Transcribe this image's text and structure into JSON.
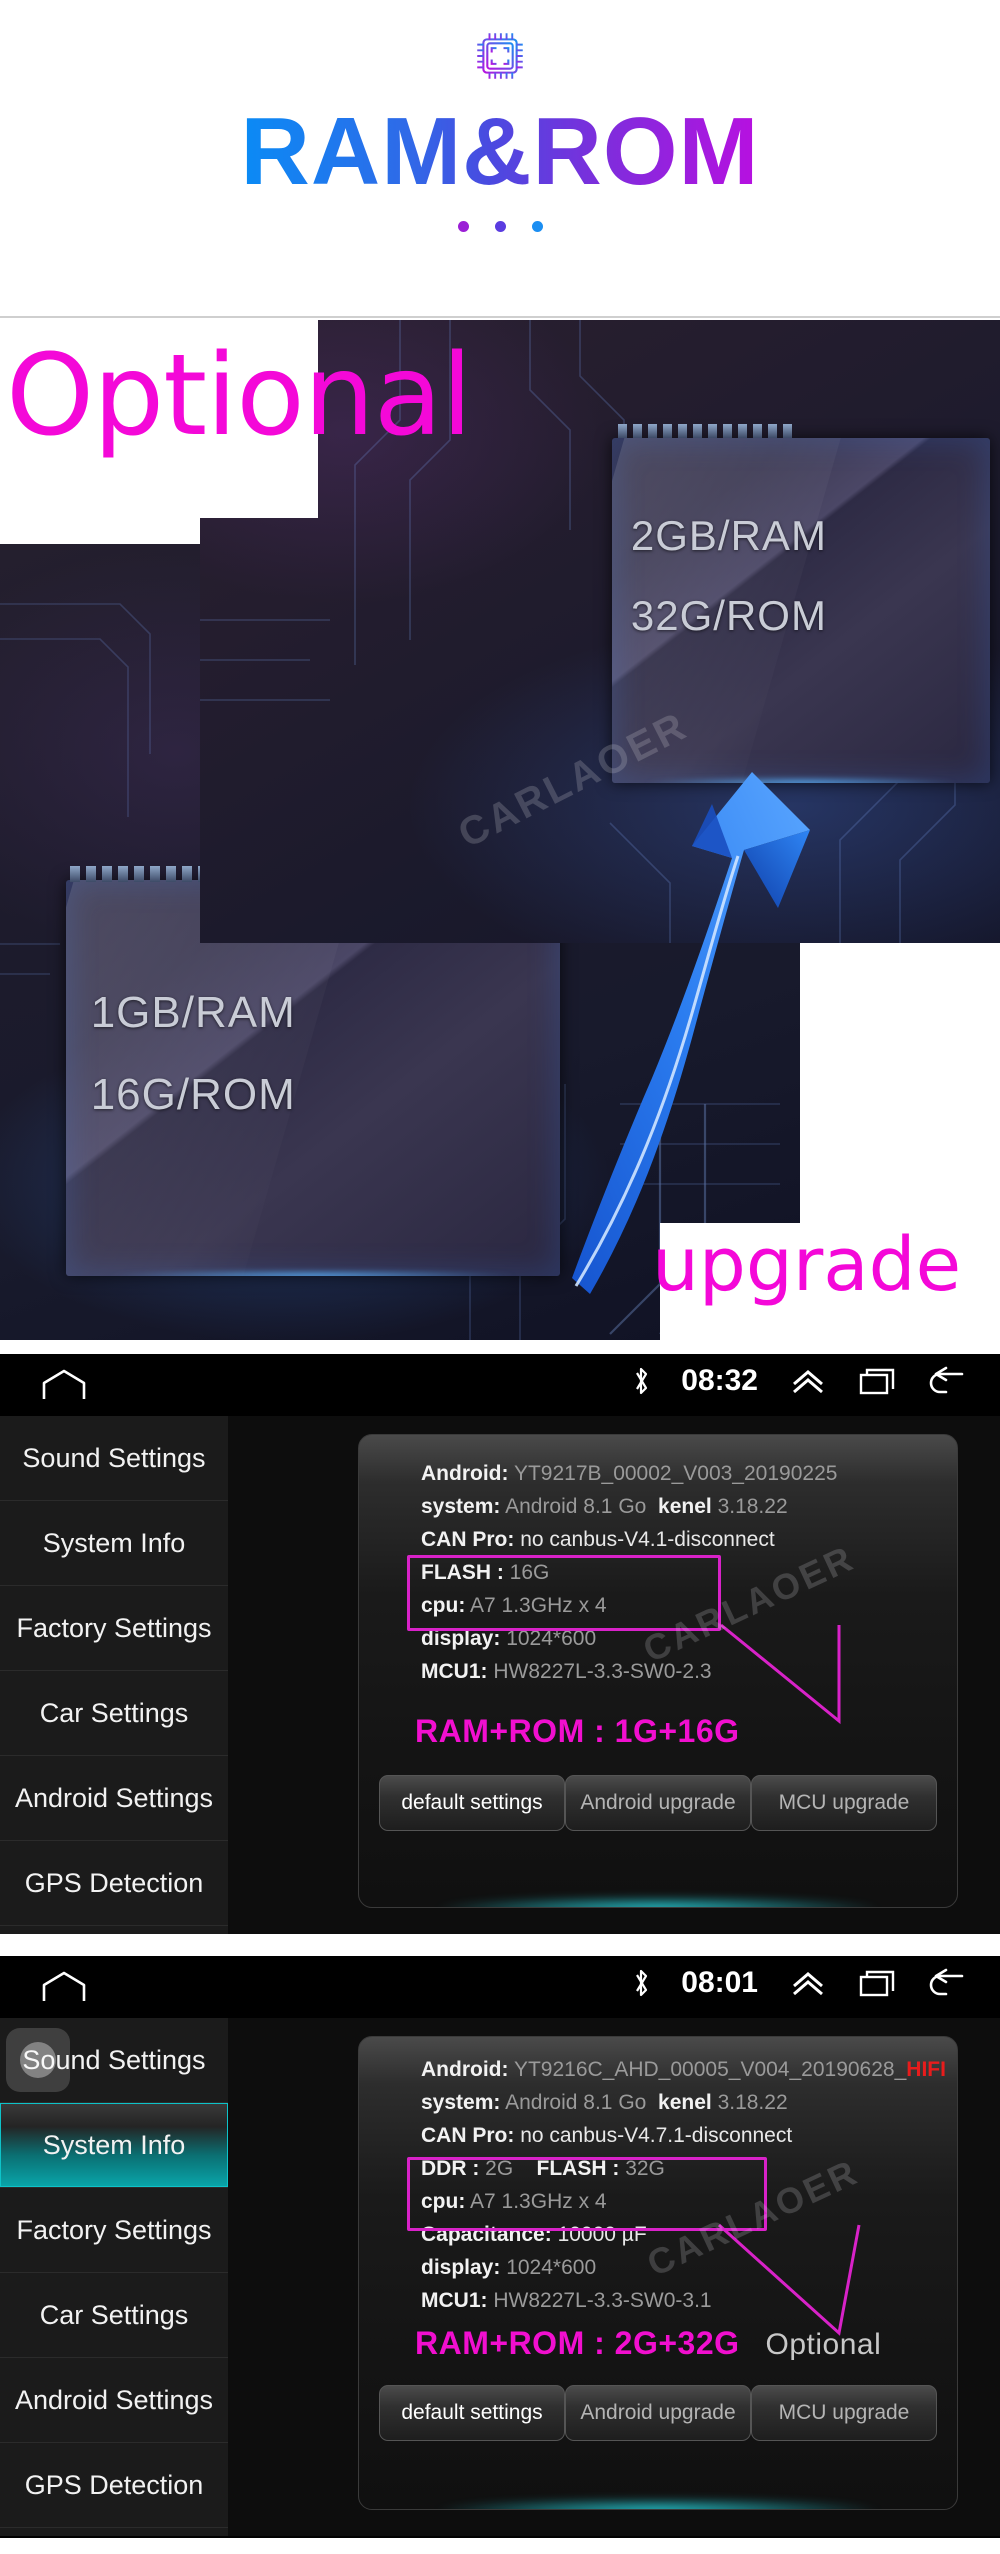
{
  "header": {
    "icon": "cpu-chip-icon",
    "title": "RAM&ROM",
    "dots": [
      "dot-purple",
      "dot-indigo",
      "dot-blue"
    ]
  },
  "hero": {
    "optional_label": "Optional",
    "upgrade_label": "upgrade",
    "watermark": "CARLAOER",
    "chip_top": {
      "line1": "2GB/RAM",
      "line2": "32G/ROM"
    },
    "chip_bottom": {
      "line1": "1GB/RAM",
      "line2": "16G/ROM"
    },
    "arrow_color": "#1f6fe0"
  },
  "screenshots": [
    {
      "id": "screenshot-1g-16g",
      "statusbar": {
        "home_icon": "home-icon",
        "bluetooth_icon": "bluetooth-icon",
        "time": "08:32",
        "expand_icon": "chevron-up-double-icon",
        "recents_icon": "recents-icon",
        "back_icon": "back-icon"
      },
      "sidebar": {
        "items": [
          {
            "label": "Sound Settings",
            "active": false
          },
          {
            "label": "System Info",
            "active": false
          },
          {
            "label": "Factory Settings",
            "active": false
          },
          {
            "label": "Car Settings",
            "active": false
          },
          {
            "label": "Android Settings",
            "active": false
          },
          {
            "label": "GPS Detection",
            "active": false
          }
        ]
      },
      "info": [
        {
          "key": "Android:",
          "value": "YT9217B_00002_V003_20190225"
        },
        {
          "key": "system:",
          "value": "Android 8.1 Go",
          "key2": "kenel",
          "value2": "3.18.22"
        },
        {
          "key": "CAN Pro:",
          "value": "no canbus-V4.1-disconnect",
          "bright": true
        },
        {
          "key": "FLASH :",
          "value": "16G"
        },
        {
          "key": "cpu:",
          "value": "A7 1.3GHz x 4"
        },
        {
          "key": "display:",
          "value": "1024*600"
        },
        {
          "key": "MCU1:",
          "value": "HW8227L-3.3-SW0-2.3"
        }
      ],
      "ramrom_label": "RAM+ROM : 1G+16G",
      "optional_tag": "",
      "buttons": [
        "default settings",
        "Android upgrade",
        "MCU upgrade"
      ],
      "watermark": "CARLAOER"
    },
    {
      "id": "screenshot-2g-32g",
      "statusbar": {
        "home_icon": "home-icon",
        "bluetooth_icon": "bluetooth-icon",
        "time": "08:01",
        "expand_icon": "chevron-up-double-icon",
        "recents_icon": "recents-icon",
        "back_icon": "back-icon"
      },
      "sidebar": {
        "items": [
          {
            "label": "Sound Settings",
            "active": false
          },
          {
            "label": "System Info",
            "active": true
          },
          {
            "label": "Factory Settings",
            "active": false
          },
          {
            "label": "Car Settings",
            "active": false
          },
          {
            "label": "Android Settings",
            "active": false
          },
          {
            "label": "GPS Detection",
            "active": false
          }
        ]
      },
      "info": [
        {
          "key": "Android:",
          "value": "YT9216C_AHD_00005_V004_20190628_",
          "suffix": "HIFI"
        },
        {
          "key": "system:",
          "value": "Android 8.1 Go",
          "key2": "kenel",
          "value2": "3.18.22"
        },
        {
          "key": "CAN Pro:",
          "value": "no canbus-V4.7.1-disconnect",
          "bright": true
        },
        {
          "key": "DDR :",
          "value": "2G",
          "key2": "FLASH :",
          "value2": "32G"
        },
        {
          "key": "cpu:",
          "value": "A7 1.3GHz x 4"
        },
        {
          "key": "Capacitance:",
          "value": "10000 µF",
          "bright": true
        },
        {
          "key": "display:",
          "value": "1024*600"
        },
        {
          "key": "MCU1:",
          "value": "HW8227L-3.3-SW0-3.1"
        }
      ],
      "ramrom_label": "RAM+ROM : 2G+32G",
      "optional_tag": "Optional",
      "buttons": [
        "default settings",
        "Android upgrade",
        "MCU upgrade"
      ],
      "watermark": "CARLAOER"
    }
  ],
  "colors": {
    "magenta": "#f10fcf",
    "teal": "#09a6ab",
    "highlight_box": "#d822c8",
    "brand_blue": "#0a8bf5",
    "brand_purple": "#b810e0"
  }
}
